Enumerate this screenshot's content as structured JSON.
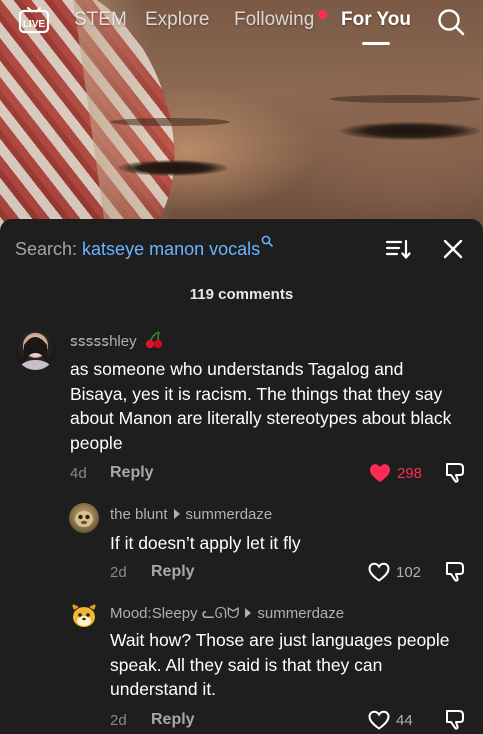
{
  "nav": {
    "live_label": "LIVE",
    "items": [
      "STEM",
      "Explore",
      "Following",
      "For You"
    ],
    "active_index": 3
  },
  "panel": {
    "search_prefix": "Search: ",
    "search_query": "katseye manon vocals",
    "comment_count": "119 comments"
  },
  "comments": [
    {
      "username": "ꜱꜱꜱꜱꜱhley",
      "text": "as someone who understands Tagalog and Bisaya, yes it is racism. The things that they say about Manon are literally stereotypes about black people",
      "date": "4d",
      "reply_label": "Reply",
      "likes": "298",
      "liked": true
    },
    {
      "username": "the blunt",
      "reply_to": "summerdaze",
      "text": "If it doesn’t apply let it fly",
      "date": "2d",
      "reply_label": "Reply",
      "likes": "102",
      "liked": false
    },
    {
      "username": "Mood:Sleepy ᓚᘏᗢ",
      "reply_to": "summerdaze",
      "text": "Wait how? Those are just languages people speak. All they said is that they can understand it.",
      "date": "2d",
      "reply_label": "Reply",
      "likes": "44",
      "liked": false
    }
  ],
  "colors": {
    "accent_pink": "#fe2c55",
    "search_query_blue": "#69b4ff",
    "panel_bg": "#1e1e1e"
  },
  "icons": [
    "live-tv-icon",
    "search-icon",
    "sort-icon",
    "close-icon",
    "cherry-emoji",
    "heart-icon",
    "dislike-icon"
  ]
}
